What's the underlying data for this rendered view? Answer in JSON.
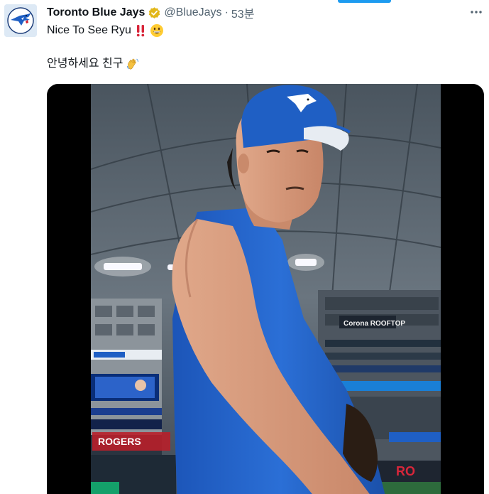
{
  "tweet": {
    "display_name": "Toronto Blue Jays",
    "handle": "@BlueJays",
    "separator": "·",
    "time": "53분",
    "text_line1": "Nice To See Ryu",
    "text_line2": "안녕하세요 친구",
    "icons": {
      "avatar": "blue-jays-logo",
      "verified": "verified-gold-badge-icon",
      "more": "more-horizontal-icon",
      "emoji1": "double-exclamation-icon",
      "emoji2": "grinning-face-icon",
      "emoji3": "waving-hand-icon"
    },
    "colors": {
      "accent": "#1d9bf0",
      "verified_gold": "#e2b719",
      "secondary_text": "#536471",
      "jersey_blue": "#1f5fc4"
    }
  },
  "media": {
    "type": "video",
    "signage": {
      "rogers": "ROGERS",
      "corona": "Corona ROOFTOP",
      "partial_rogers": "RO"
    }
  }
}
